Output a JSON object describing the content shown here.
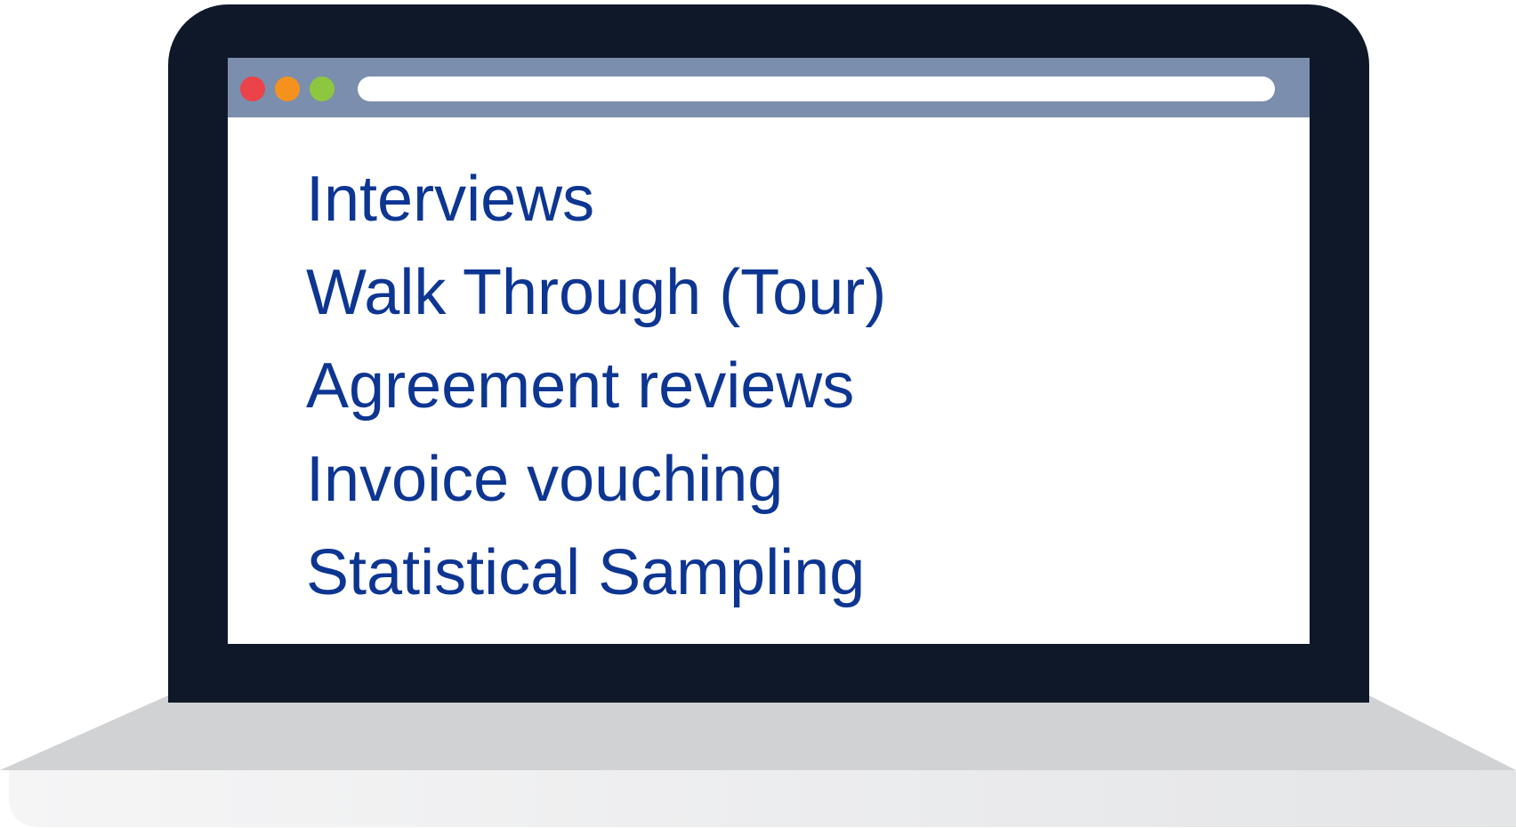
{
  "colors": {
    "laptop_frame": "#0f1829",
    "toolbar": "#7b8ead",
    "dot_red": "#ec4249",
    "dot_orange": "#f5921e",
    "dot_green": "#8dc63f",
    "text": "#0d3592",
    "base_top": "#d1d2d4",
    "base_bottom": "#e6e7e8"
  },
  "browser": {
    "window_controls": [
      "close-dot",
      "minimize-dot",
      "maximize-dot"
    ],
    "address_bar_value": ""
  },
  "content": {
    "items": [
      "Interviews",
      "Walk Through (Tour)",
      "Agreement reviews",
      "Invoice vouching",
      "Statistical Sampling"
    ]
  }
}
